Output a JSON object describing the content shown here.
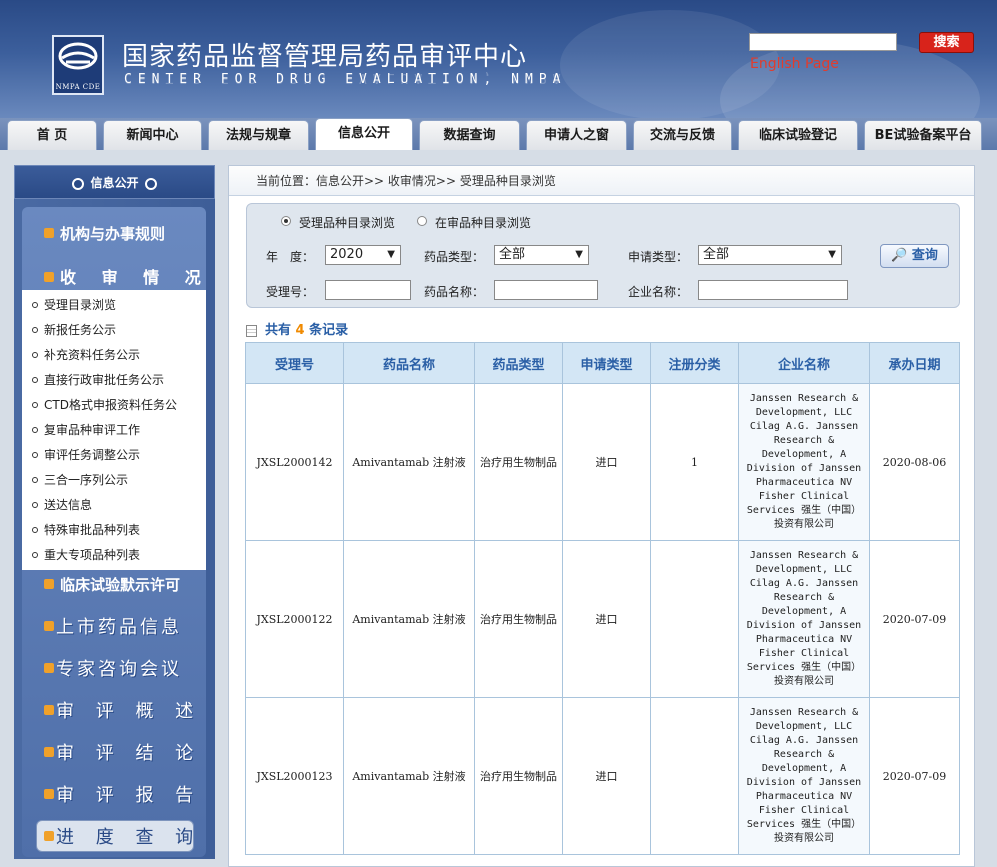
{
  "header": {
    "title": "国家药品监督管理局药品审评中心",
    "subtitle": "CENTER FOR DRUG EVALUATION, NMPA",
    "logo_text": "NMPA CDE",
    "search_value": "",
    "search_button": "搜索",
    "english_link": "English Page"
  },
  "nav": {
    "tabs": [
      "首 页",
      "新闻中心",
      "法规与规章",
      "信息公开",
      "数据查询",
      "申请人之窗",
      "交流与反馈",
      "临床试验登记",
      "BE试验备案平台"
    ],
    "active_index": 3
  },
  "sidebar": {
    "head": "信息公开",
    "section1": "机构与办事规则",
    "section2": "收 审 情 况",
    "items": [
      "受理目录浏览",
      "新报任务公示",
      "补充资料任务公示",
      "直接行政审批任务公示",
      "CTD格式申报资料任务公",
      "复审品种审评工作",
      "审评任务调整公示",
      "三合一序列公示",
      "送达信息",
      "特殊审批品种列表",
      "重大专项品种列表"
    ],
    "section3": "临床试验默示许可",
    "big_sections": [
      "上市药品信息",
      "专家咨询会议",
      "审 评 概 述",
      "审 评 结 论",
      "审 评 报 告",
      "进 度 查 询"
    ]
  },
  "content": {
    "breadcrumb": "当前位置：信息公开>> 收审情况>> 受理品种目录浏览",
    "radio1": "受理品种目录浏览",
    "radio2": "在审品种目录浏览",
    "radio_selected": 1,
    "filters": {
      "year_label": "年　度：",
      "year_value": "2020",
      "type_label": "药品类型：",
      "type_value": "全部",
      "apply_label": "申请类型：",
      "apply_value": "全部",
      "acc_label": "受理号：",
      "acc_value": "",
      "name_label": "药品名称：",
      "name_value": "",
      "company_label": "企业名称：",
      "company_value": "",
      "query_button": "查询"
    },
    "count_prefix": "共有",
    "count": "4",
    "count_suffix": "条记录",
    "table": {
      "headers": [
        "受理号",
        "药品名称",
        "药品类型",
        "申请类型",
        "注册分类",
        "企业名称",
        "承办日期"
      ],
      "rows": [
        [
          "JXSL2000142",
          "Amivantamab 注射液",
          "治疗用生物制品",
          "进口",
          "1",
          "Janssen Research & Development, LLC Cilag A.G. Janssen Research & Development, A Division of Janssen Pharmaceutica NV Fisher Clinical Services 强生（中国）投资有限公司",
          "2020-08-06"
        ],
        [
          "JXSL2000122",
          "Amivantamab 注射液",
          "治疗用生物制品",
          "进口",
          "",
          "Janssen Research & Development, LLC Cilag A.G. Janssen Research & Development, A Division of Janssen Pharmaceutica NV Fisher Clinical Services 强生（中国）投资有限公司",
          "2020-07-09"
        ],
        [
          "JXSL2000123",
          "Amivantamab 注射液",
          "治疗用生物制品",
          "进口",
          "",
          "Janssen Research & Development, LLC Cilag A.G. Janssen Research & Development, A Division of Janssen Pharmaceutica NV Fisher Clinical Services 强生（中国）投资有限公司",
          "2020-07-09"
        ]
      ]
    }
  }
}
